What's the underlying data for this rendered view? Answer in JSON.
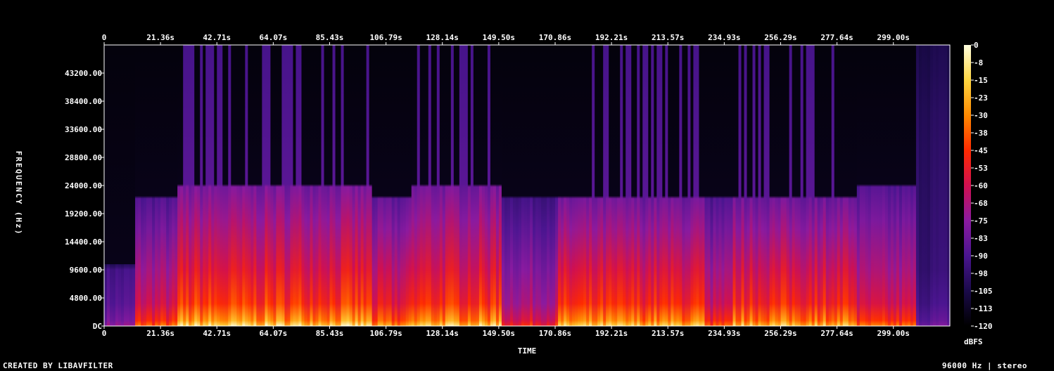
{
  "chart_data": {
    "type": "heatmap",
    "xlabel": "TIME",
    "ylabel": "FREQUENCY (Hz)",
    "x_ticks": [
      "0",
      "21.36s",
      "42.71s",
      "64.07s",
      "85.43s",
      "106.79s",
      "128.14s",
      "149.50s",
      "170.86s",
      "192.21s",
      "213.57s",
      "234.93s",
      "256.29s",
      "277.64s",
      "299.00s"
    ],
    "x_tick_values": [
      0,
      21.36,
      42.71,
      64.07,
      85.43,
      106.79,
      128.14,
      149.5,
      170.86,
      192.21,
      213.57,
      234.93,
      256.29,
      277.64,
      299.0
    ],
    "xlim": [
      0,
      320.4
    ],
    "y_ticks": [
      "DC",
      "4800.00",
      "9600.00",
      "14400.00",
      "19200.00",
      "24000.00",
      "28800.00",
      "33600.00",
      "38400.00",
      "43200.00"
    ],
    "y_tick_values": [
      0,
      4800,
      9600,
      14400,
      19200,
      24000,
      28800,
      33600,
      38400,
      43200
    ],
    "ylim": [
      0,
      48000
    ],
    "colorbar": {
      "label": "dBFS",
      "ticks": [
        "0",
        "-8",
        "-15",
        "-23",
        "-30",
        "-38",
        "-45",
        "-53",
        "-60",
        "-68",
        "-75",
        "-83",
        "-90",
        "-98",
        "-105",
        "-113",
        "-120"
      ],
      "range": [
        -120,
        0
      ],
      "colormap": [
        "#000000",
        "#1a0a4a",
        "#4a1590",
        "#8a1aa0",
        "#d01050",
        "#ff2a00",
        "#ff8a00",
        "#ffd640",
        "#ffffe0"
      ]
    },
    "segments": [
      {
        "start": 0,
        "end": 12,
        "bandwidth_hz": 10000,
        "level": 0.35
      },
      {
        "start": 12,
        "end": 28,
        "bandwidth_hz": 22000,
        "level": 0.62
      },
      {
        "start": 28,
        "end": 101,
        "bandwidth_hz": 24000,
        "level": 0.8
      },
      {
        "start": 101,
        "end": 116,
        "bandwidth_hz": 22000,
        "level": 0.68
      },
      {
        "start": 116,
        "end": 151,
        "bandwidth_hz": 24000,
        "level": 0.78
      },
      {
        "start": 151,
        "end": 172,
        "bandwidth_hz": 22000,
        "level": 0.55
      },
      {
        "start": 172,
        "end": 228,
        "bandwidth_hz": 22000,
        "level": 0.76
      },
      {
        "start": 228,
        "end": 238,
        "bandwidth_hz": 22000,
        "level": 0.6
      },
      {
        "start": 238,
        "end": 285,
        "bandwidth_hz": 22000,
        "level": 0.76
      },
      {
        "start": 285,
        "end": 308,
        "bandwidth_hz": 24000,
        "level": 0.62
      },
      {
        "start": 308,
        "end": 320.4,
        "bandwidth_hz": 48000,
        "level": 0.3
      }
    ],
    "transient_regions": [
      {
        "start": 28,
        "end": 101
      },
      {
        "start": 119,
        "end": 146
      },
      {
        "start": 172,
        "end": 226
      },
      {
        "start": 238,
        "end": 278
      }
    ]
  },
  "footer": {
    "credit": "CREATED BY LIBAVFILTER",
    "format": "96000 Hz | stereo"
  }
}
